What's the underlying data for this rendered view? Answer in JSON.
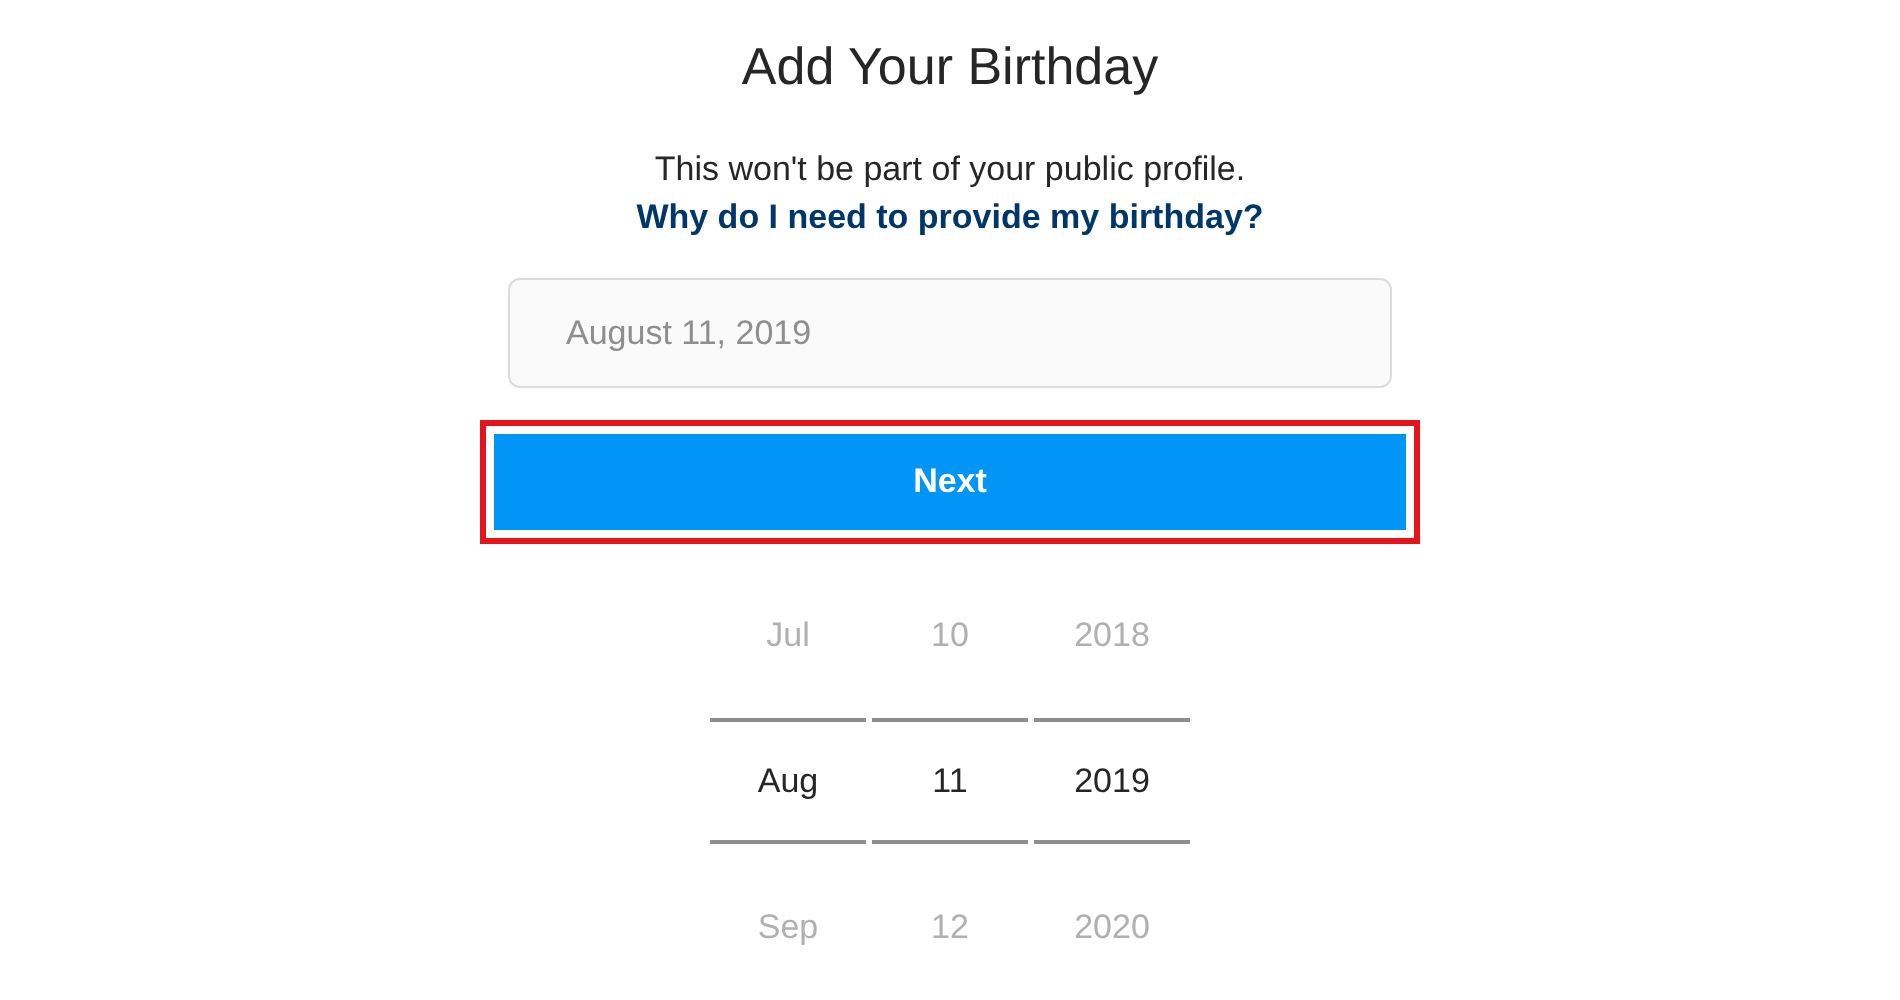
{
  "title": "Add Your Birthday",
  "subtitle": "This won't be part of your public profile.",
  "help_link": "Why do I need to provide my birthday?",
  "date_field": {
    "placeholder": "August 11, 2019"
  },
  "next_button": {
    "label": "Next",
    "highlighted": true
  },
  "picker": [
    {
      "items": [
        {
          "label": "Jul",
          "selected": false
        },
        {
          "label": "Aug",
          "selected": true
        },
        {
          "label": "Sep",
          "selected": false
        }
      ]
    },
    {
      "items": [
        {
          "label": "10",
          "selected": false
        },
        {
          "label": "11",
          "selected": true
        },
        {
          "label": "12",
          "selected": false
        }
      ]
    },
    {
      "items": [
        {
          "label": "2018",
          "selected": false
        },
        {
          "label": "2019",
          "selected": true
        },
        {
          "label": "2020",
          "selected": false
        }
      ]
    }
  ]
}
